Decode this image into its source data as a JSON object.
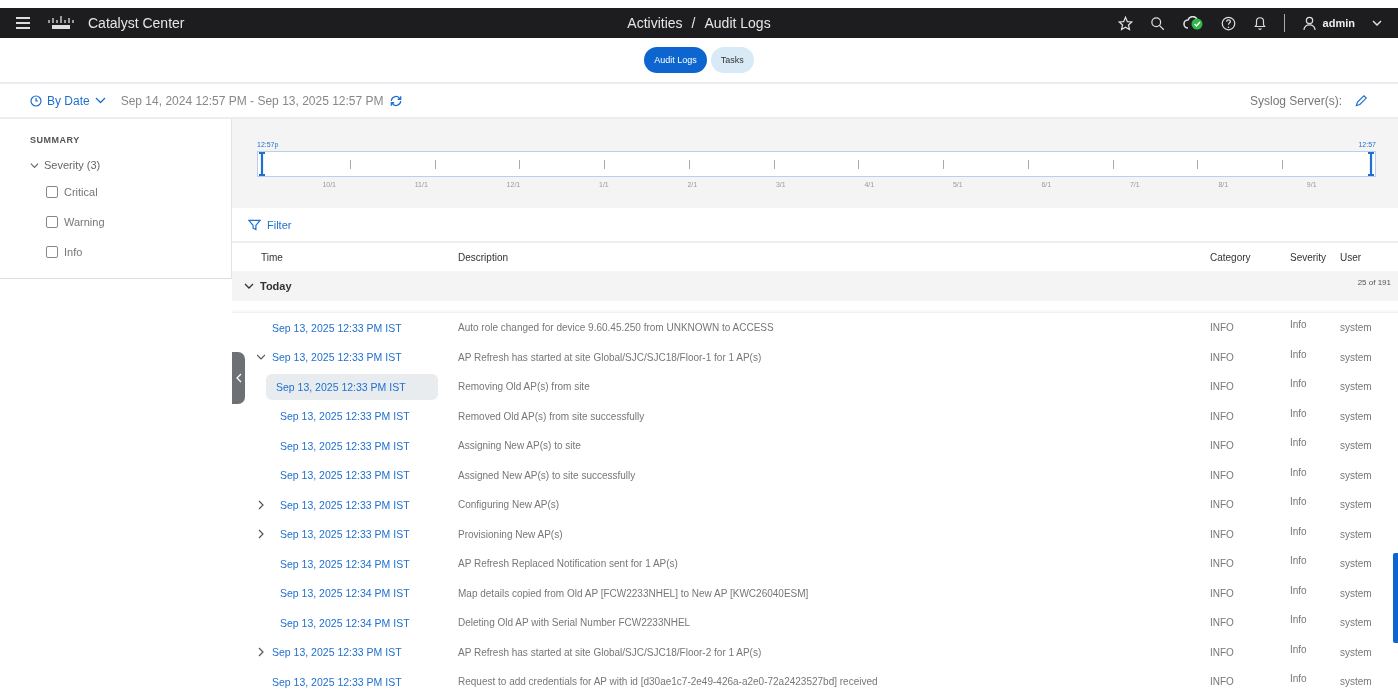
{
  "header": {
    "product": "Catalyst Center",
    "breadcrumb": [
      "Activities",
      "Audit Logs"
    ],
    "separator": "/",
    "user": "admin"
  },
  "tabs": [
    {
      "label": "Audit Logs",
      "selected": true
    },
    {
      "label": "Tasks",
      "selected": false
    }
  ],
  "date_bar": {
    "mode": "By Date",
    "range": "Sep 14, 2024 12:57 PM - Sep 13, 2025 12:57 PM",
    "syslog_label": "Syslog Server(s):"
  },
  "sidebar": {
    "title": "SUMMARY",
    "group": {
      "label": "Severity (3)",
      "expanded": true,
      "items": [
        {
          "label": "Critical",
          "checked": false
        },
        {
          "label": "Warning",
          "checked": false
        },
        {
          "label": "Info",
          "checked": false
        }
      ]
    }
  },
  "timeline": {
    "start": "12:57p",
    "end": "12:57",
    "ticks": [
      "10/1",
      "11/1",
      "12/1",
      "1/1",
      "2/1",
      "3/1",
      "4/1",
      "5/1",
      "6/1",
      "7/1",
      "8/1",
      "9/1"
    ]
  },
  "filter": "Filter",
  "table": {
    "columns": [
      "Time",
      "Description",
      "Category",
      "Severity",
      "User"
    ],
    "group": {
      "label": "Today",
      "expanded": true,
      "count": "25 of 191"
    },
    "rows": [
      {
        "time": "Sep 13, 2025 12:33 PM IST",
        "description": "Auto role changed for device 9.60.45.250 from UNKNOWN to ACCESS",
        "category": "INFO",
        "severity": "Info",
        "user": "system",
        "selected": false
      },
      {
        "time": "Sep 13, 2025 12:33 PM IST",
        "description": "AP Refresh has started at site Global/SJC/SJC18/Floor-1 for 1 AP(s)",
        "category": "INFO",
        "severity": "Info",
        "user": "system",
        "selected": false,
        "expanded": true,
        "children": [
          {
            "time": "Sep 13, 2025 12:33 PM IST",
            "description": "Removing Old AP(s) from site",
            "category": "INFO",
            "severity": "Info",
            "user": "system",
            "selected": true
          },
          {
            "time": "Sep 13, 2025 12:33 PM IST",
            "description": "Removed Old AP(s) from site successfully",
            "category": "INFO",
            "severity": "Info",
            "user": "system",
            "selected": false
          },
          {
            "time": "Sep 13, 2025 12:33 PM IST",
            "description": "Assigning New AP(s) to site",
            "category": "INFO",
            "severity": "Info",
            "user": "system",
            "selected": false
          },
          {
            "time": "Sep 13, 2025 12:33 PM IST",
            "description": "Assigned New AP(s) to site successfully",
            "category": "INFO",
            "severity": "Info",
            "user": "system",
            "selected": false
          },
          {
            "time": "Sep 13, 2025 12:33 PM IST",
            "description": "Configuring New AP(s)",
            "category": "INFO",
            "severity": "Info",
            "user": "system",
            "selected": false,
            "expanded": false
          },
          {
            "time": "Sep 13, 2025 12:33 PM IST",
            "description": "Provisioning New AP(s)",
            "category": "INFO",
            "severity": "Info",
            "user": "system",
            "selected": false,
            "expanded": false
          },
          {
            "time": "Sep 13, 2025 12:34 PM IST",
            "description": "AP Refresh Replaced Notification sent for 1 AP(s)",
            "category": "INFO",
            "severity": "Info",
            "user": "system",
            "selected": false
          },
          {
            "time": "Sep 13, 2025 12:34 PM IST",
            "description": "Map details copied from Old AP [FCW2233NHEL] to New AP [KWC26040ESM]",
            "category": "INFO",
            "severity": "Info",
            "user": "system",
            "selected": false
          },
          {
            "time": "Sep 13, 2025 12:34 PM IST",
            "description": "Deleting Old AP with Serial Number FCW2233NHEL",
            "category": "INFO",
            "severity": "Info",
            "user": "system",
            "selected": false
          }
        ]
      },
      {
        "time": "Sep 13, 2025 12:33 PM IST",
        "description": "AP Refresh has started at site Global/SJC/SJC18/Floor-2 for 1 AP(s)",
        "category": "INFO",
        "severity": "Info",
        "user": "system",
        "selected": false,
        "expanded": false
      },
      {
        "time": "Sep 13, 2025 12:33 PM IST",
        "description": "Request to add credentials for AP with id [d30ae1c7-2e49-426a-a2e0-72a2423527bd] received",
        "category": "INFO",
        "severity": "Info",
        "user": "system",
        "selected": false
      }
    ]
  }
}
